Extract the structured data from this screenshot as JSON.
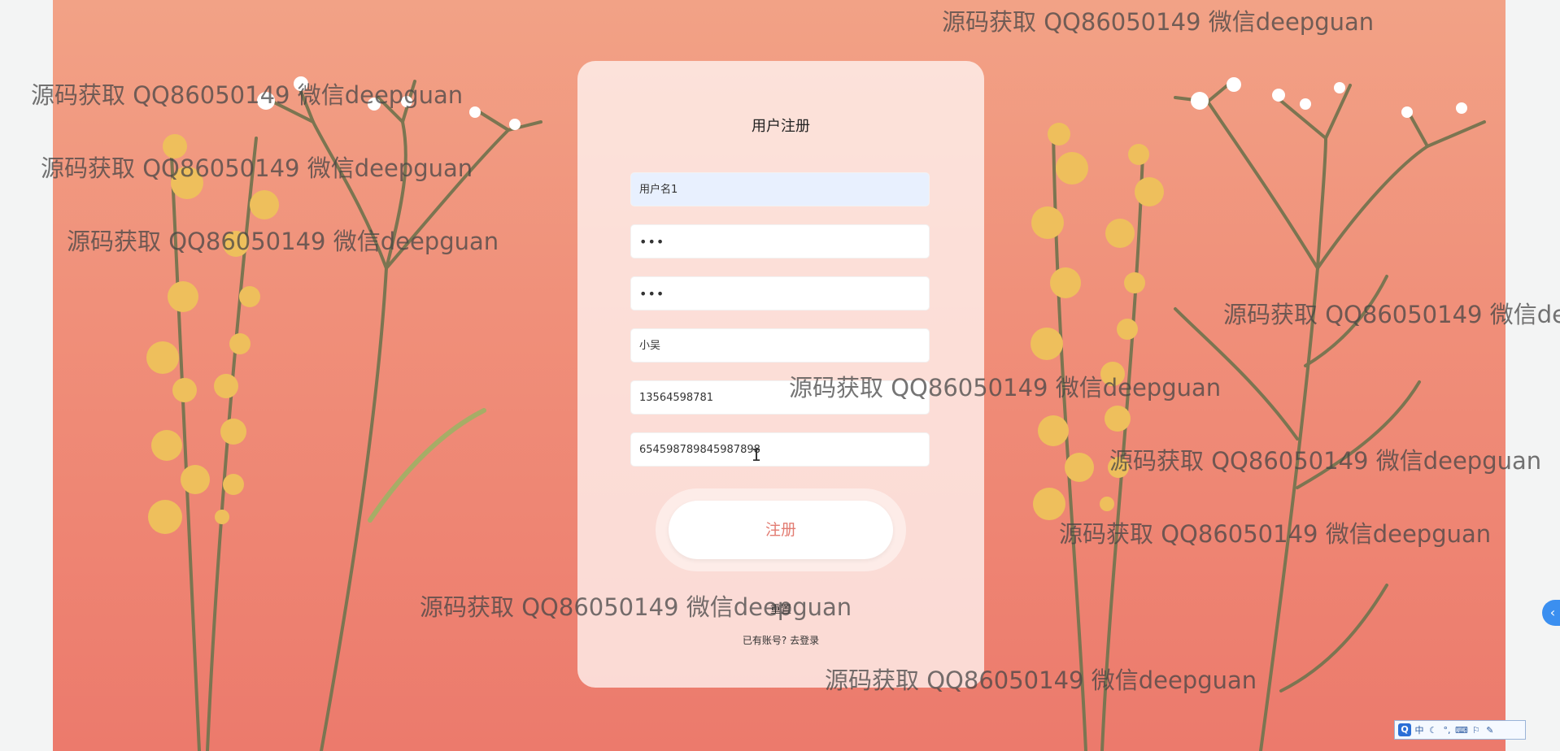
{
  "register": {
    "title": "用户注册",
    "fields": [
      {
        "name": "username",
        "value": "用户名1"
      },
      {
        "name": "password",
        "value": "•••"
      },
      {
        "name": "confirm_password",
        "value": "•••"
      },
      {
        "name": "real_name",
        "value": "小吴"
      },
      {
        "name": "phone",
        "value": "13564598781"
      },
      {
        "name": "id_number",
        "value": "654598789845987898"
      }
    ],
    "submit_label": "注册",
    "reset_label": "重置",
    "login_prompt": "已有账号?",
    "login_link": "去登录"
  },
  "watermark_text": "源码获取 QQ86050149 微信deepguan",
  "side_tab_icon": "chevron-left-icon",
  "ime_toolbar": {
    "items": [
      "Q",
      "中",
      "☾",
      "°,",
      "⌨",
      "⚐",
      "✎"
    ]
  },
  "colors": {
    "accent": "#e27c72",
    "bg_top": "#f2a286",
    "bg_bottom": "#ec7a6c"
  }
}
